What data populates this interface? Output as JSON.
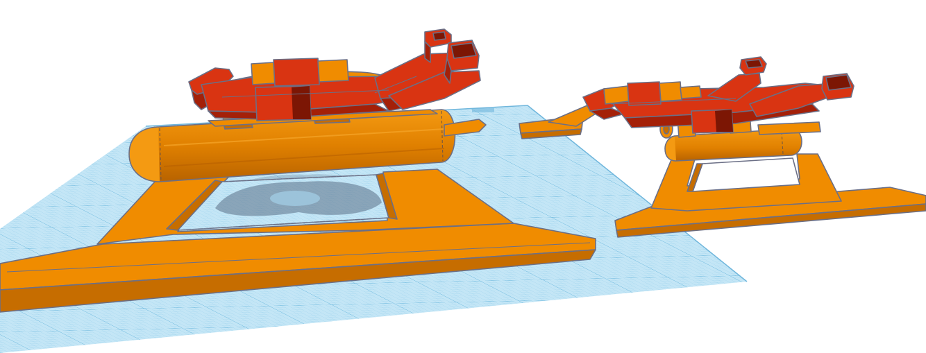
{
  "app": {
    "view": "3d-workplane",
    "colors": {
      "background": "#ffffff",
      "workplane_fill": "#bfe3f4",
      "workplane_grid": "#7fc3e6",
      "workplane_grid_major": "#5aaed8",
      "stand_orange": "#f08c00",
      "ship_red": "#d93412",
      "edge_outline": "#6b6f86"
    }
  },
  "scene": {
    "objects": [
      {
        "name": "large-stand",
        "color": "orange"
      },
      {
        "name": "large-ship",
        "color": "red"
      },
      {
        "name": "small-stand",
        "color": "orange"
      },
      {
        "name": "small-ship",
        "color": "red"
      }
    ]
  }
}
